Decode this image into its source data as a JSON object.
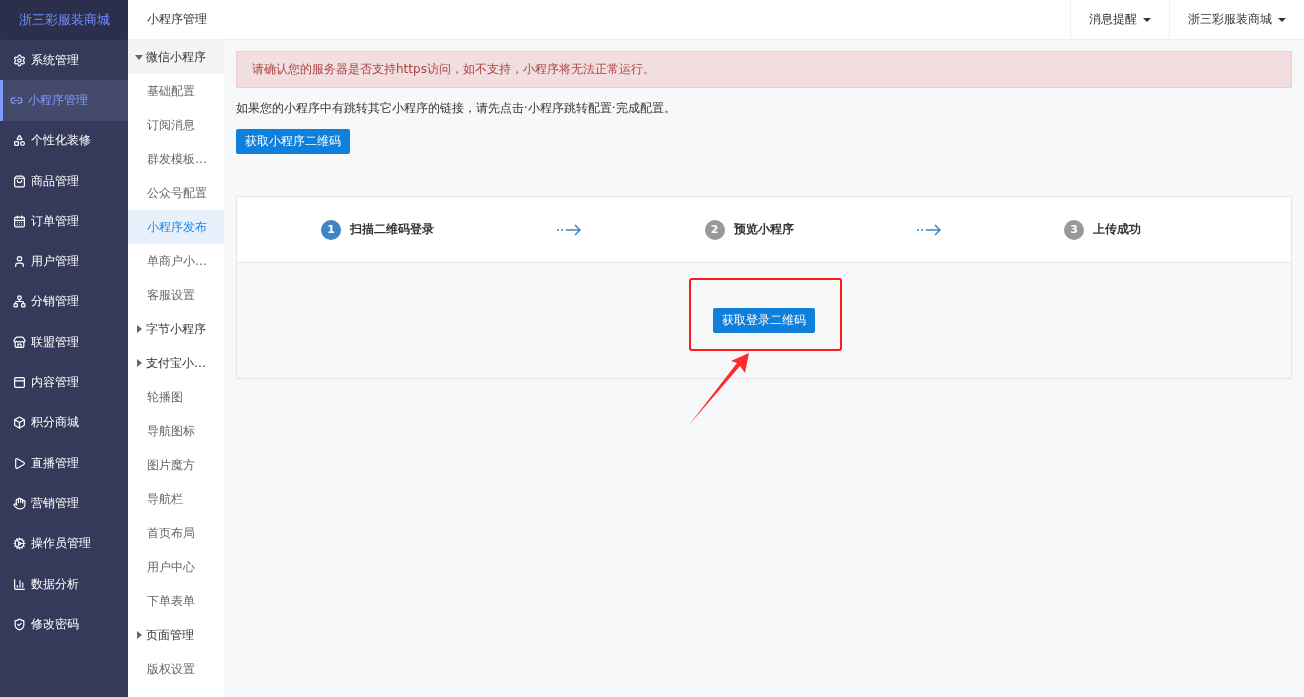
{
  "brand": "浙三彩服装商城",
  "top_bar": {
    "section_title": "小程序管理",
    "menus": [
      {
        "label": "消息提醒"
      },
      {
        "label": "浙三彩服装商城"
      }
    ]
  },
  "main_nav": [
    {
      "label": "系统管理",
      "selected": false
    },
    {
      "label": "小程序管理",
      "selected": true
    },
    {
      "label": "个性化装修",
      "selected": false
    },
    {
      "label": "商品管理",
      "selected": false
    },
    {
      "label": "订单管理",
      "selected": false
    },
    {
      "label": "用户管理",
      "selected": false
    },
    {
      "label": "分销管理",
      "selected": false
    },
    {
      "label": "联盟管理",
      "selected": false
    },
    {
      "label": "内容管理",
      "selected": false
    },
    {
      "label": "积分商城",
      "selected": false
    },
    {
      "label": "直播管理",
      "selected": false
    },
    {
      "label": "营销管理",
      "selected": false
    },
    {
      "label": "操作员管理",
      "selected": false
    },
    {
      "label": "数据分析",
      "selected": false
    },
    {
      "label": "修改密码",
      "selected": false
    }
  ],
  "sub_nav": [
    {
      "kind": "group",
      "label": "微信小程序",
      "expanded": true,
      "children": [
        {
          "label": "基础配置",
          "selected": false
        },
        {
          "label": "订阅消息",
          "selected": false
        },
        {
          "label": "群发模板…",
          "selected": false
        },
        {
          "label": "公众号配置",
          "selected": false
        },
        {
          "label": "小程序发布",
          "selected": true
        },
        {
          "label": "单商户小…",
          "selected": false
        },
        {
          "label": "客服设置",
          "selected": false
        }
      ]
    },
    {
      "kind": "group",
      "label": "字节小程序",
      "expanded": false
    },
    {
      "kind": "group",
      "label": "支付宝小…",
      "expanded": false
    },
    {
      "kind": "link",
      "label": "轮播图",
      "selected": false
    },
    {
      "kind": "link",
      "label": "导航图标",
      "selected": false
    },
    {
      "kind": "link",
      "label": "图片魔方",
      "selected": false
    },
    {
      "kind": "link",
      "label": "导航栏",
      "selected": false
    },
    {
      "kind": "link",
      "label": "首页布局",
      "selected": false
    },
    {
      "kind": "link",
      "label": "用户中心",
      "selected": false
    },
    {
      "kind": "link",
      "label": "下单表单",
      "selected": false
    },
    {
      "kind": "group",
      "label": "页面管理",
      "expanded": false
    },
    {
      "kind": "link",
      "label": "版权设置",
      "selected": false
    }
  ],
  "alert": "请确认您的服务器是否支持https访问，如不支持，小程序将无法正常运行。",
  "notice": "如果您的小程序中有跳转其它小程序的链接，请先点击·小程序跳转配置·完成配置。",
  "qr_button": "获取小程序二维码",
  "steps": [
    {
      "number": "1",
      "label": "扫描二维码登录",
      "active": true
    },
    {
      "number": "2",
      "label": "预览小程序",
      "active": false
    },
    {
      "number": "3",
      "label": "上传成功",
      "active": false
    }
  ],
  "login_button": "获取登录二维码"
}
